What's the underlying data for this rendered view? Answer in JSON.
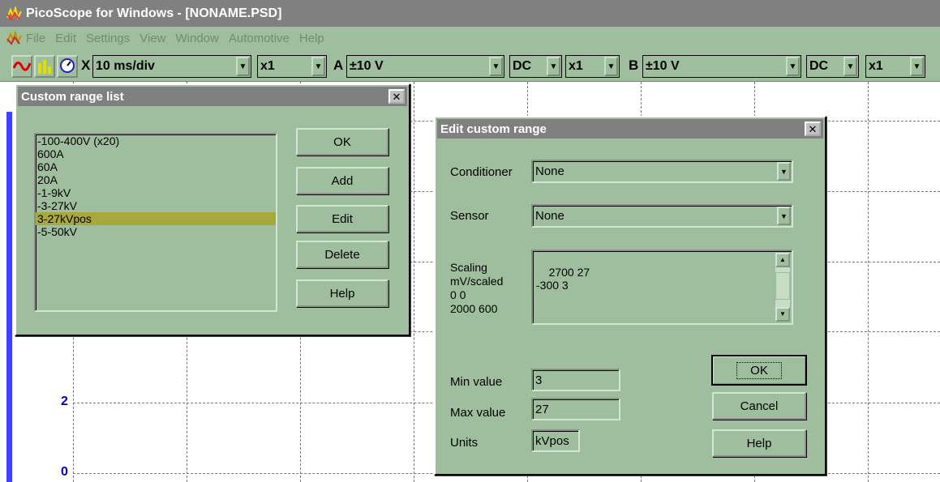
{
  "window": {
    "title": "PicoScope for Windows - [NONAME.PSD]"
  },
  "menu": {
    "items": [
      {
        "label": "File",
        "underline": "F"
      },
      {
        "label": "Edit",
        "underline": "E"
      },
      {
        "label": "Settings",
        "underline": ""
      },
      {
        "label": "View",
        "underline": "V"
      },
      {
        "label": "Window",
        "underline": "W"
      },
      {
        "label": "Automotive",
        "underline": ""
      },
      {
        "label": "Help",
        "underline": "H"
      }
    ]
  },
  "toolbar": {
    "x_label": "X",
    "timebase": "10 ms/div",
    "x_mult": "x1",
    "a_label": "A",
    "a_range": "±10 V",
    "a_coupling": "DC",
    "a_mult": "x1",
    "b_label": "B",
    "b_range": "±10 V",
    "b_coupling": "DC",
    "b_mult": "x1"
  },
  "scope": {
    "y_labels": [
      "2",
      "0"
    ]
  },
  "custom_range_list": {
    "title": "Custom range list",
    "items": [
      "-100-400V (x20)",
      "600A",
      "60A",
      "20A",
      "-1-9kV",
      "-3-27kV",
      "3-27kVpos",
      "-5-50kV"
    ],
    "selected_index": 6,
    "buttons": {
      "ok": "OK",
      "add": "Add",
      "edit": "Edit",
      "delete": "Delete",
      "help": "Help"
    }
  },
  "edit_custom_range": {
    "title": "Edit custom range",
    "conditioner_label": "Conditioner",
    "conditioner_value": "None",
    "sensor_label": "Sensor",
    "sensor_value": "None",
    "scaling_label": "Scaling\nmV/scaled\n0 0\n2000 600",
    "scaling_text": "2700 27\n-300 3",
    "min_label": "Min value",
    "min_value": "3",
    "max_label": "Max value",
    "max_value": "27",
    "units_label": "Units",
    "units_value": "kVpos",
    "buttons": {
      "ok": "OK",
      "cancel": "Cancel",
      "help": "Help"
    }
  },
  "colors": {
    "dialog_bg": "#9ebe9e",
    "titlebar": "#808080",
    "selection": "#a8a83c",
    "trace_axis": "#4040ff"
  }
}
